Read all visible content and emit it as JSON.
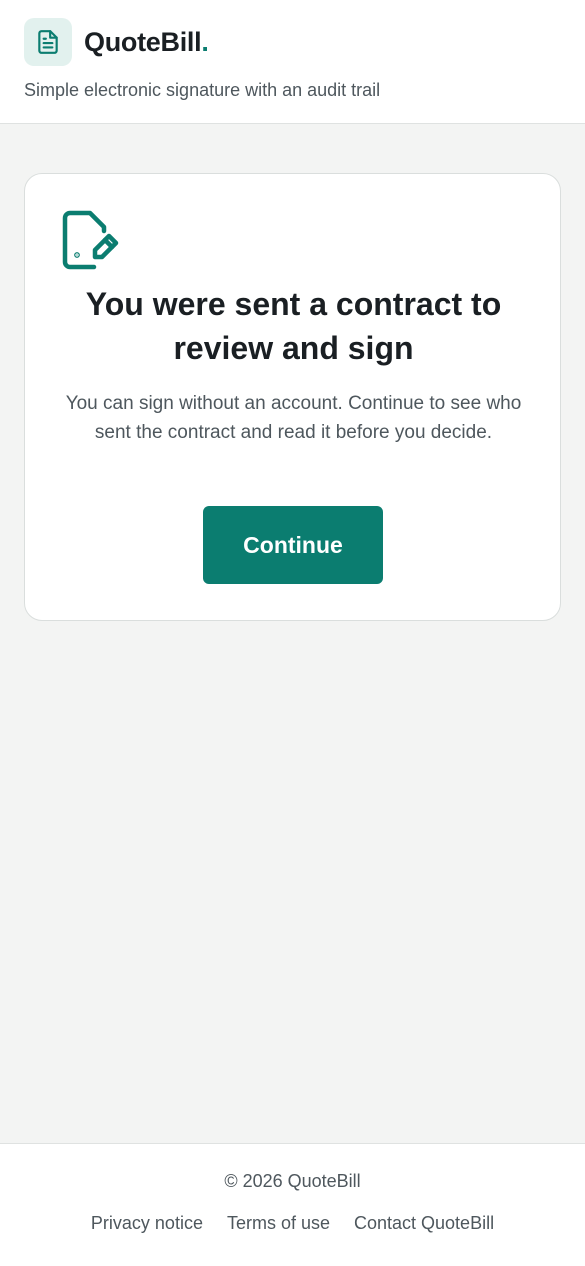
{
  "header": {
    "logo_icon": "document-icon",
    "brand_name": "QuoteBill",
    "brand_dot": ".",
    "tagline": "Simple electronic signature with an audit trail"
  },
  "card": {
    "icon": "document-sign-icon",
    "title": "You were sent a contract to review and sign",
    "body": "You can sign without an account. Continue to see who sent the contract and read it before you decide.",
    "continue_label": "Continue"
  },
  "footer": {
    "copyright": "© 2026 QuoteBill",
    "links": [
      {
        "label": "Privacy notice"
      },
      {
        "label": "Terms of use"
      },
      {
        "label": "Contact QuoteBill"
      }
    ]
  },
  "colors": {
    "accent": "#0b7d70",
    "background": "#f3f4f3",
    "logo_bg": "#e2f1ee"
  }
}
